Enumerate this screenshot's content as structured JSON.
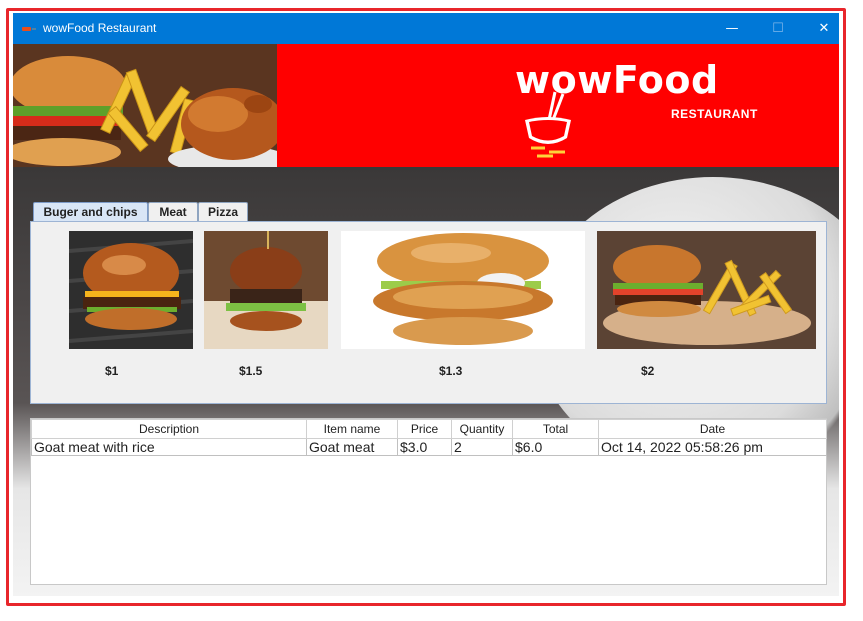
{
  "window": {
    "title": "wowFood Restaurant",
    "minimize": "—",
    "maximize": "☐",
    "close": "✕"
  },
  "banner": {
    "brand": "wowFood",
    "subtitle": "RESTAURANT"
  },
  "tabs": [
    {
      "label": "Buger and chips",
      "active": true
    },
    {
      "label": "Meat",
      "active": false
    },
    {
      "label": "Pizza",
      "active": false
    }
  ],
  "items": [
    {
      "image": "burger-image-1",
      "price": "$1"
    },
    {
      "image": "burger-image-2",
      "price": "$1.5"
    },
    {
      "image": "chicken-burger-image",
      "price": "$1.3"
    },
    {
      "image": "burger-and-fries-image",
      "price": "$2"
    }
  ],
  "orders": {
    "columns": [
      "Description",
      "Item name",
      "Price",
      "Quantity",
      "Total",
      "Date"
    ],
    "rows": [
      [
        "Goat meat with rice",
        "Goat meat",
        "$3.0",
        "2",
        "$6.0",
        "Oct 14, 2022 05:58:26 pm"
      ]
    ]
  },
  "colors": {
    "titlebar": "#0078d7",
    "banner_red": "#ff0000",
    "frame": "#e8262b"
  }
}
